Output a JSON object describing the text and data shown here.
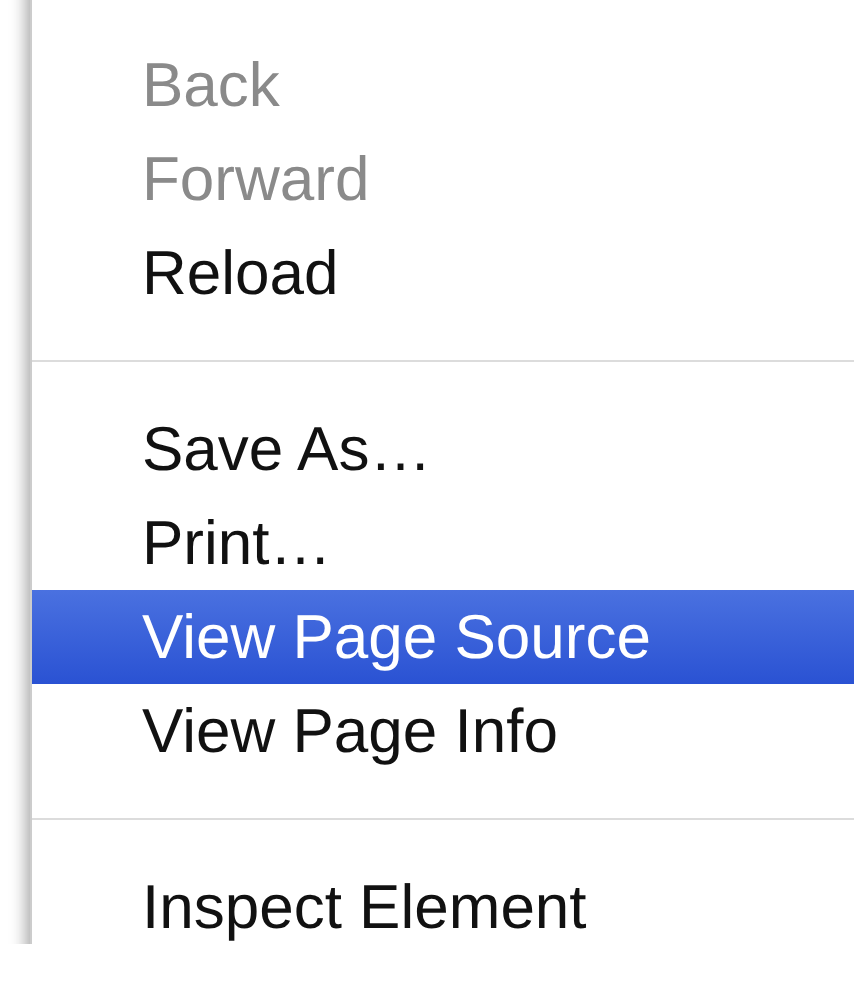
{
  "menu": {
    "items": [
      {
        "kind": "item",
        "label": "Back",
        "disabled": true,
        "selected": false
      },
      {
        "kind": "item",
        "label": "Forward",
        "disabled": true,
        "selected": false
      },
      {
        "kind": "item",
        "label": "Reload",
        "disabled": false,
        "selected": false
      },
      {
        "kind": "separator"
      },
      {
        "kind": "item",
        "label": "Save As…",
        "disabled": false,
        "selected": false
      },
      {
        "kind": "item",
        "label": "Print…",
        "disabled": false,
        "selected": false
      },
      {
        "kind": "item",
        "label": "View Page Source",
        "disabled": false,
        "selected": true
      },
      {
        "kind": "item",
        "label": "View Page Info",
        "disabled": false,
        "selected": false
      },
      {
        "kind": "separator"
      },
      {
        "kind": "item",
        "label": "Inspect Element",
        "disabled": false,
        "selected": false
      }
    ]
  }
}
